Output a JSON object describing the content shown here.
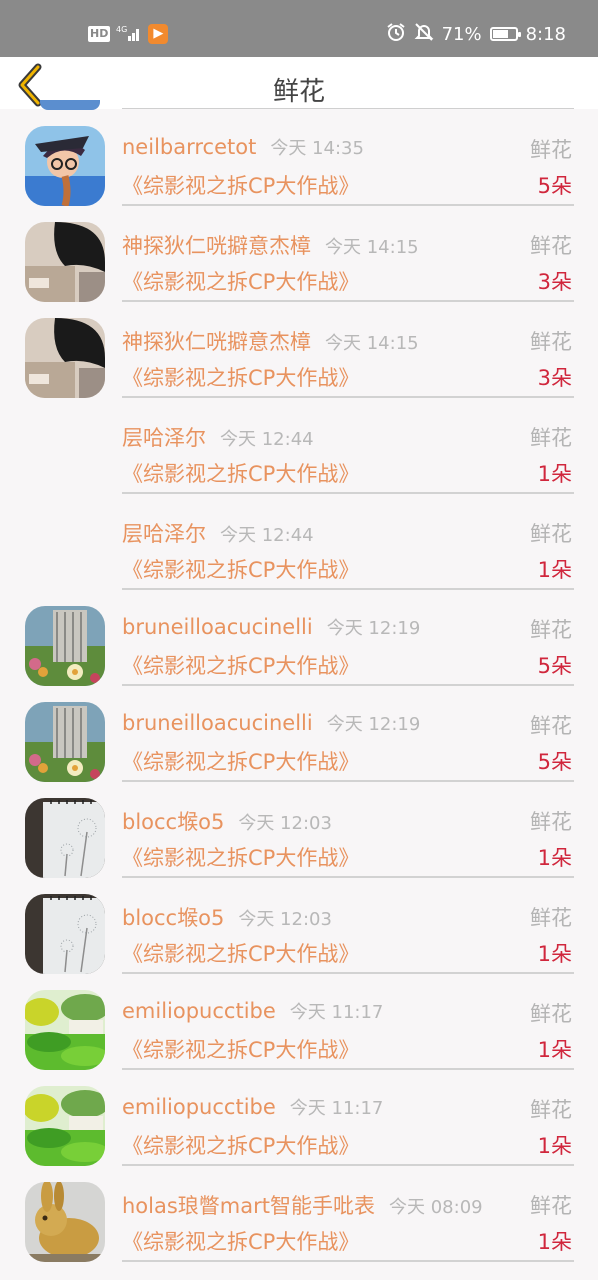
{
  "status_bar": {
    "hd": "HD",
    "signal": "4G",
    "app_badge": "▶",
    "battery": "71%",
    "battery_level": 0.71,
    "time": "8:18"
  },
  "header": {
    "title": "鲜花",
    "back_icon": "chevron-left-icon",
    "accent_color": "#f0b400"
  },
  "list": [
    {
      "user": "neilbarrcetot",
      "time": "今天 14:35",
      "type": "鲜花",
      "show": "《综影视之拆CP大作战》",
      "amount": "5朵",
      "avatar": "girl"
    },
    {
      "user": "神探狄仁咣擗意杰樟",
      "time": "今天 14:15",
      "type": "鲜花",
      "show": "《综影视之拆CP大作战》",
      "amount": "3朵",
      "avatar": "dark"
    },
    {
      "user": "神探狄仁咣擗意杰樟",
      "time": "今天 14:15",
      "type": "鲜花",
      "show": "《综影视之拆CP大作战》",
      "amount": "3朵",
      "avatar": "dark"
    },
    {
      "user": "层哈泽尔",
      "time": "今天 12:44",
      "type": "鲜花",
      "show": "《综影视之拆CP大作战》",
      "amount": "1朵",
      "avatar": "none"
    },
    {
      "user": "层哈泽尔",
      "time": "今天 12:44",
      "type": "鲜花",
      "show": "《综影视之拆CP大作战》",
      "amount": "1朵",
      "avatar": "none"
    },
    {
      "user": "bruneilloacucinelli",
      "time": "今天 12:19",
      "type": "鲜花",
      "show": "《综影视之拆CP大作战》",
      "amount": "5朵",
      "avatar": "garden"
    },
    {
      "user": "bruneilloacucinelli",
      "time": "今天 12:19",
      "type": "鲜花",
      "show": "《综影视之拆CP大作战》",
      "amount": "5朵",
      "avatar": "garden"
    },
    {
      "user": "blocc堠o5",
      "time": "今天 12:03",
      "type": "鲜花",
      "show": "《综影视之拆CP大作战》",
      "amount": "1朵",
      "avatar": "dandelion"
    },
    {
      "user": "blocc堠o5",
      "time": "今天 12:03",
      "type": "鲜花",
      "show": "《综影视之拆CP大作战》",
      "amount": "1朵",
      "avatar": "dandelion"
    },
    {
      "user": "emiliopucctibe",
      "time": "今天 11:17",
      "type": "鲜花",
      "show": "《综影视之拆CP大作战》",
      "amount": "1朵",
      "avatar": "green"
    },
    {
      "user": "emiliopucctibe",
      "time": "今天 11:17",
      "type": "鲜花",
      "show": "《综影视之拆CP大作战》",
      "amount": "1朵",
      "avatar": "green"
    },
    {
      "user": "holas琅瞥mart智能手吡表",
      "time": "今天 08:09",
      "type": "鲜花",
      "show": "《综影视之拆CP大作战》",
      "amount": "1朵",
      "avatar": "rabbit"
    }
  ],
  "colors": {
    "username": "#e8935f",
    "amount": "#d0263c",
    "muted": "#b4b4b4"
  }
}
